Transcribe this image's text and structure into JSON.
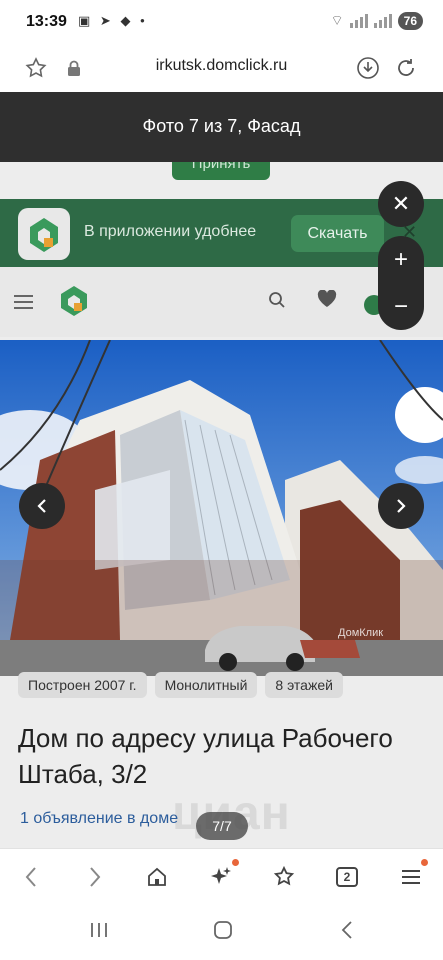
{
  "status": {
    "time": "13:39",
    "notification_icons": [
      "screenshot-icon",
      "telegram-icon",
      "chat-icon",
      "dot-icon"
    ],
    "battery": "76"
  },
  "browser": {
    "url": "irkutsk.domclick.ru"
  },
  "viewer": {
    "title": "Фото 7 из 7, Фасад",
    "counter": "7/7",
    "controls": [
      "close-icon",
      "zoom-in-icon",
      "zoom-out-icon",
      "prev-arrow-icon",
      "next-arrow-icon"
    ]
  },
  "page": {
    "accept_label": "Принять",
    "banner_text": "В приложении удобнее",
    "download_label": "Скачать",
    "tags": [
      "Построен 2007 г.",
      "Монолитный",
      "8 этажей"
    ],
    "heading": "Дом по адресу улица Рабочего Штаба, 3/2",
    "ad_link": "1 объявление в доме",
    "watermark": "циан",
    "photo_watermark": "ДомКлик"
  },
  "colors": {
    "viewer_bg": "#2f2f2f",
    "brand_green": "#2e6a46",
    "link_blue": "#2c5d9c",
    "badge_orange": "#e8663a"
  }
}
